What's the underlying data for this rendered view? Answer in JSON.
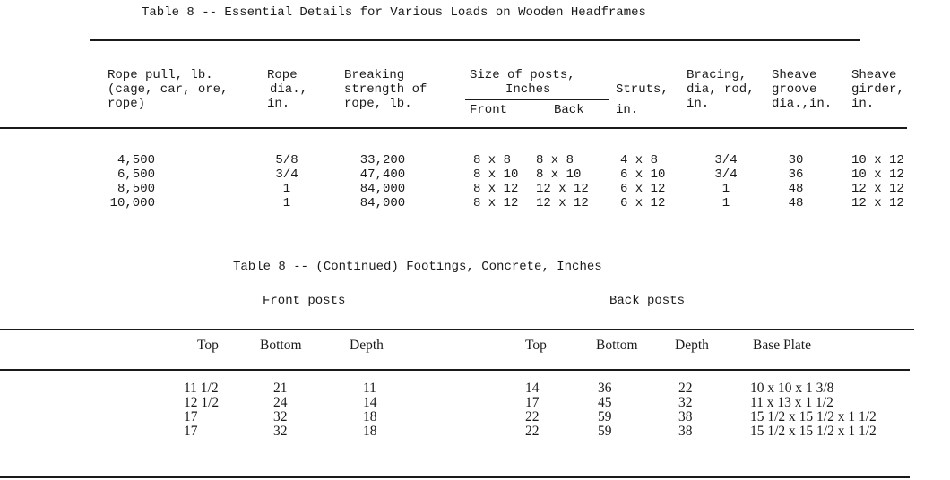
{
  "table1": {
    "title": "Table 8 -- Essential Details for Various Loads on Wooden Headframes",
    "headers": {
      "rope_pull": [
        "Rope pull, lb.",
        "(cage, car, ore,",
        "rope)"
      ],
      "rope_dia": [
        "Rope",
        "dia.,",
        "in."
      ],
      "breaking": [
        "Breaking",
        "strength of",
        "rope, lb."
      ],
      "posts_group": "Size of posts,",
      "posts_unit": "Inches",
      "posts_front": "Front",
      "posts_back": "Back",
      "struts": [
        "Struts,",
        "in."
      ],
      "bracing": [
        "Bracing,",
        "dia, rod,",
        "in."
      ],
      "sheave_groove": [
        "Sheave",
        "groove",
        "dia.,in."
      ],
      "sheave_girder": [
        "Sheave",
        "girder,",
        "in."
      ]
    },
    "rows": [
      {
        "rope_pull": "4,500",
        "rope_dia": "5/8",
        "breaking": "33,200",
        "front": "8 x 8",
        "back": "8 x 8",
        "struts": "4 x 8",
        "bracing": "3/4",
        "sheave_groove": "30",
        "sheave_girder": "10 x 12"
      },
      {
        "rope_pull": "6,500",
        "rope_dia": "3/4",
        "breaking": "47,400",
        "front": "8 x 10",
        "back": "8 x 10",
        "struts": "6 x 10",
        "bracing": "3/4",
        "sheave_groove": "36",
        "sheave_girder": "10 x 12"
      },
      {
        "rope_pull": "8,500",
        "rope_dia": "1",
        "breaking": "84,000",
        "front": "8 x 12",
        "back": "12 x 12",
        "struts": "6 x 12",
        "bracing": "1",
        "sheave_groove": "48",
        "sheave_girder": "12 x 12"
      },
      {
        "rope_pull": "10,000",
        "rope_dia": "1",
        "breaking": "84,000",
        "front": "8 x 12",
        "back": "12 x 12",
        "struts": "6 x 12",
        "bracing": "1",
        "sheave_groove": "48",
        "sheave_girder": "12 x 12"
      }
    ]
  },
  "table2": {
    "title": "Table 8 -- (Continued) Footings, Concrete, Inches",
    "group_front": "Front posts",
    "group_back": "Back posts",
    "headers": {
      "f_top": "Top",
      "f_bottom": "Bottom",
      "f_depth": "Depth",
      "b_top": "Top",
      "b_bottom": "Bottom",
      "b_depth": "Depth",
      "base_plate": "Base Plate"
    },
    "rows": [
      {
        "f_top": "11 1/2",
        "f_bottom": "21",
        "f_depth": "11",
        "b_top": "14",
        "b_bottom": "36",
        "b_depth": "22",
        "base_plate": "10 x 10 x 1 3/8"
      },
      {
        "f_top": "12 1/2",
        "f_bottom": "24",
        "f_depth": "14",
        "b_top": "17",
        "b_bottom": "45",
        "b_depth": "32",
        "base_plate": "11 x 13 x 1 1/2"
      },
      {
        "f_top": "17",
        "f_bottom": "32",
        "f_depth": "18",
        "b_top": "22",
        "b_bottom": "59",
        "b_depth": "38",
        "base_plate": "15 1/2 x 15 1/2 x 1 1/2"
      },
      {
        "f_top": "17",
        "f_bottom": "32",
        "f_depth": "18",
        "b_top": "22",
        "b_bottom": "59",
        "b_depth": "38",
        "base_plate": "15 1/2 x 15 1/2 x 1 1/2"
      }
    ]
  }
}
